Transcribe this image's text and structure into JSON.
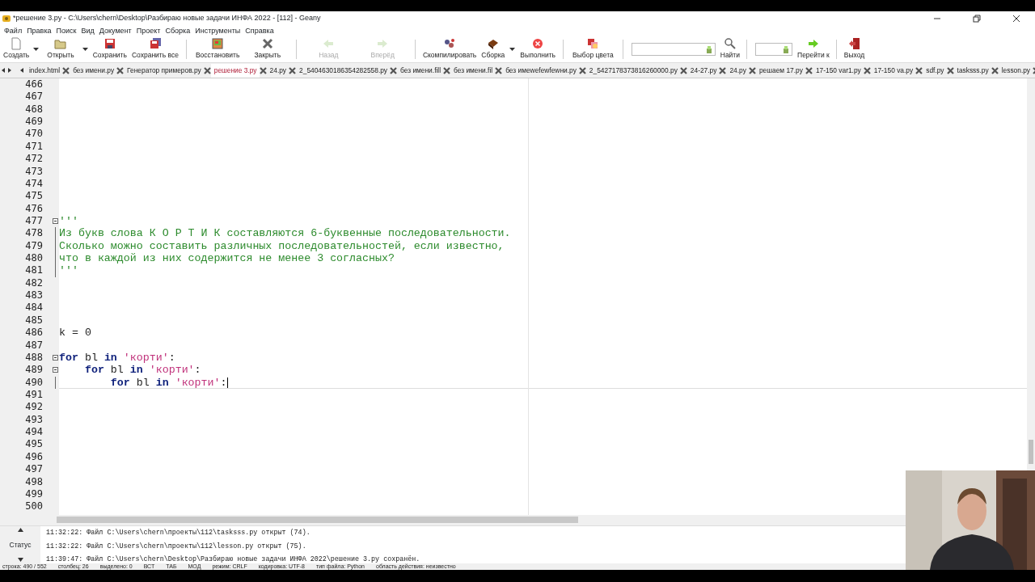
{
  "window": {
    "title": "*решение 3.py - C:\\Users\\chern\\Desktop\\Разбираю новые задачи ИНФА 2022 - [112] - Geany"
  },
  "menu": [
    "Файл",
    "Правка",
    "Поиск",
    "Вид",
    "Документ",
    "Проект",
    "Сборка",
    "Инструменты",
    "Справка"
  ],
  "toolbar": [
    {
      "kind": "button",
      "label": "Создать",
      "disabled": false
    },
    {
      "kind": "dropdown"
    },
    {
      "kind": "button",
      "label": "Открыть",
      "disabled": false
    },
    {
      "kind": "dropdown"
    },
    {
      "kind": "button",
      "label": "Сохранить",
      "disabled": false
    },
    {
      "kind": "button",
      "label": "Сохранить все",
      "disabled": false
    },
    {
      "kind": "separator"
    },
    {
      "kind": "button",
      "label": "Восстановить",
      "disabled": false
    },
    {
      "kind": "button",
      "label": "Закрыть",
      "disabled": false
    },
    {
      "kind": "separator"
    },
    {
      "kind": "button",
      "label": "Назад",
      "disabled": true
    },
    {
      "kind": "button",
      "label": "Вперёд",
      "disabled": true
    },
    {
      "kind": "separator"
    },
    {
      "kind": "button",
      "label": "Скомпилировать",
      "disabled": false
    },
    {
      "kind": "button",
      "label": "Сборка",
      "disabled": false
    },
    {
      "kind": "dropdown"
    },
    {
      "kind": "button",
      "label": "Выполнить",
      "disabled": false
    },
    {
      "kind": "separator"
    },
    {
      "kind": "button",
      "label": "Выбор цвета",
      "disabled": false
    },
    {
      "kind": "separator"
    },
    {
      "kind": "search_field"
    },
    {
      "kind": "button",
      "label": "Найти",
      "disabled": false
    },
    {
      "kind": "separator"
    },
    {
      "kind": "goto_field"
    },
    {
      "kind": "button",
      "label": "Перейти к",
      "disabled": false
    },
    {
      "kind": "separator"
    },
    {
      "kind": "button",
      "label": "Выход",
      "disabled": false
    }
  ],
  "tabs": [
    {
      "label": "index.html",
      "selected": false
    },
    {
      "label": "без имени.py",
      "selected": false
    },
    {
      "label": "Генератор примеров.py",
      "selected": false
    },
    {
      "label": "решение 3.py",
      "selected": true
    },
    {
      "label": "24.py",
      "selected": false
    },
    {
      "label": "2_5404630186354282558.py",
      "selected": false
    },
    {
      "label": "без имени.fill",
      "selected": false
    },
    {
      "label": "без имени.fil",
      "selected": false
    },
    {
      "label": "без имewefewfewни.py",
      "selected": false
    },
    {
      "label": "2_5427178373816260000.py",
      "selected": false
    },
    {
      "label": "24-27.py",
      "selected": false
    },
    {
      "label": "24.py",
      "selected": false
    },
    {
      "label": "решаем 17.py",
      "selected": false
    },
    {
      "label": "17-150 var1.py",
      "selected": false
    },
    {
      "label": "17-150 va.py",
      "selected": false
    },
    {
      "label": "sdf.py",
      "selected": false
    },
    {
      "label": "tasksss.py",
      "selected": false
    },
    {
      "label": "lesson.py",
      "selected": false
    }
  ],
  "editor": {
    "lines": [
      {
        "number": "466"
      },
      {
        "number": "467"
      },
      {
        "number": "468"
      },
      {
        "number": "469"
      },
      {
        "number": "470"
      },
      {
        "number": "471"
      },
      {
        "number": "472"
      },
      {
        "number": "473"
      },
      {
        "number": "474"
      },
      {
        "number": "475"
      },
      {
        "number": "476"
      },
      {
        "number": "477",
        "fold_marker": true,
        "tokens": [
          {
            "kind": "comment",
            "text": "'''"
          }
        ]
      },
      {
        "number": "478",
        "in_fold": true,
        "tokens": [
          {
            "kind": "comment",
            "text": "Из букв слова К О Р Т И К составляются 6-буквенные последовательности."
          }
        ]
      },
      {
        "number": "479",
        "in_fold": true,
        "tokens": [
          {
            "kind": "comment",
            "text": "Сколько можно составить различных последовательностей, если известно,"
          }
        ]
      },
      {
        "number": "480",
        "in_fold": true,
        "tokens": [
          {
            "kind": "comment",
            "text": "что в каждой из них содержится не менее 3 согласных?"
          }
        ]
      },
      {
        "number": "481",
        "in_fold": true,
        "tokens": [
          {
            "kind": "comment",
            "text": "'''"
          }
        ]
      },
      {
        "number": "482"
      },
      {
        "number": "483"
      },
      {
        "number": "484"
      },
      {
        "number": "485"
      },
      {
        "number": "486",
        "tokens": [
          {
            "kind": "plain",
            "text": "k = 0"
          }
        ]
      },
      {
        "number": "487"
      },
      {
        "number": "488",
        "fold_marker": true,
        "tokens": [
          {
            "kind": "keyword",
            "text": "for"
          },
          {
            "kind": "plain",
            "text": " bl "
          },
          {
            "kind": "keyword",
            "text": "in"
          },
          {
            "kind": "string",
            "text": " 'корти'"
          },
          {
            "kind": "plain",
            "text": ":"
          }
        ]
      },
      {
        "number": "489",
        "fold_marker": true,
        "tokens": [
          {
            "kind": "keyword",
            "text": "    for"
          },
          {
            "kind": "plain",
            "text": " bl "
          },
          {
            "kind": "keyword",
            "text": "in"
          },
          {
            "kind": "string",
            "text": " 'корти'"
          },
          {
            "kind": "plain",
            "text": ":"
          }
        ]
      },
      {
        "number": "490",
        "in_fold": true,
        "current": true,
        "tokens": [
          {
            "kind": "keyword",
            "text": "        for"
          },
          {
            "kind": "plain",
            "text": " bl "
          },
          {
            "kind": "keyword",
            "text": "in"
          },
          {
            "kind": "string",
            "text": " 'корти'"
          },
          {
            "kind": "plain",
            "text": ":"
          }
        ]
      },
      {
        "number": "491"
      },
      {
        "number": "492"
      },
      {
        "number": "493"
      },
      {
        "number": "494"
      },
      {
        "number": "495"
      },
      {
        "number": "496"
      },
      {
        "number": "497"
      },
      {
        "number": "498"
      },
      {
        "number": "499"
      },
      {
        "number": "500"
      }
    ]
  },
  "messages": {
    "tab": "Статус",
    "items": [
      "11:32:22: Файл C:\\Users\\chern\\проекты\\112\\tasksss.py открыт (74).",
      "11:32:22: Файл C:\\Users\\chern\\проекты\\112\\lesson.py открыт (75).",
      "11:39:47: Файл C:\\Users\\chern\\Desktop\\Разбираю новые задачи ИНФА 2022\\решение 3.py сохранён."
    ]
  },
  "status_bar": [
    "строка: 490 / 552",
    "столбец: 26",
    "выделено: 0",
    "ВСТ",
    "ТАБ",
    "МОД",
    "режим: CRLF",
    "кодировка: UTF-8",
    "тип файла: Python",
    "область действия: неизвестно"
  ],
  "webcam": {
    "kind": "picture"
  }
}
